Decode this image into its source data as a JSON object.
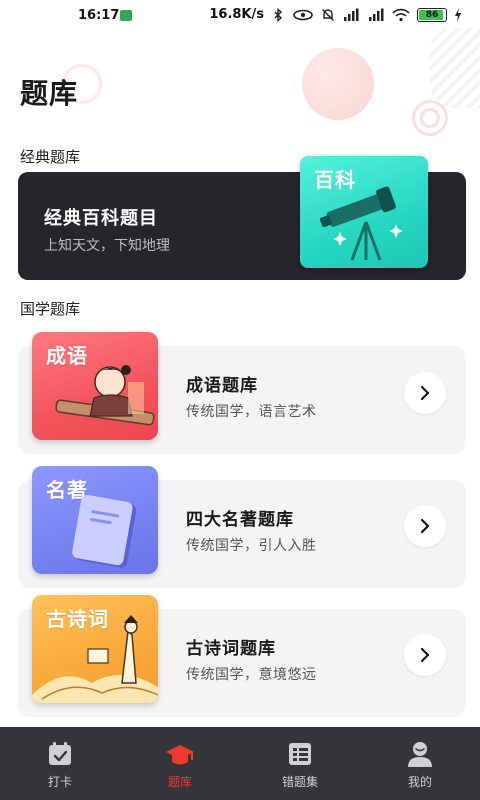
{
  "status_bar": {
    "time": "16:17",
    "network_speed": "16.8K/s",
    "battery_level": "86"
  },
  "page": {
    "title": "题库"
  },
  "sections": {
    "classic": {
      "label": "经典题库",
      "card": {
        "title": "经典百科题目",
        "subtitle": "上知天文，下知地理",
        "badge": "百科",
        "badge_color": "#27d7c2"
      }
    },
    "guoxue": {
      "label": "国学题库",
      "items": [
        {
          "badge": "成语",
          "title": "成语题库",
          "subtitle": "传统国学，语言艺术",
          "color": "#f45a62"
        },
        {
          "badge": "名著",
          "title": "四大名著题库",
          "subtitle": "传统国学，引人入胜",
          "color": "#7b86f2"
        },
        {
          "badge": "古诗词",
          "title": "古诗词题库",
          "subtitle": "传统国学，意境悠远",
          "color": "#f8a93a"
        }
      ]
    }
  },
  "bottom_nav": {
    "active_color": "#f03a2e",
    "items": [
      {
        "label": "打卡",
        "icon": "calendar-check-icon"
      },
      {
        "label": "题库",
        "icon": "graduation-cap-icon"
      },
      {
        "label": "错题集",
        "icon": "wrong-questions-icon"
      },
      {
        "label": "我的",
        "icon": "user-icon"
      }
    ]
  }
}
